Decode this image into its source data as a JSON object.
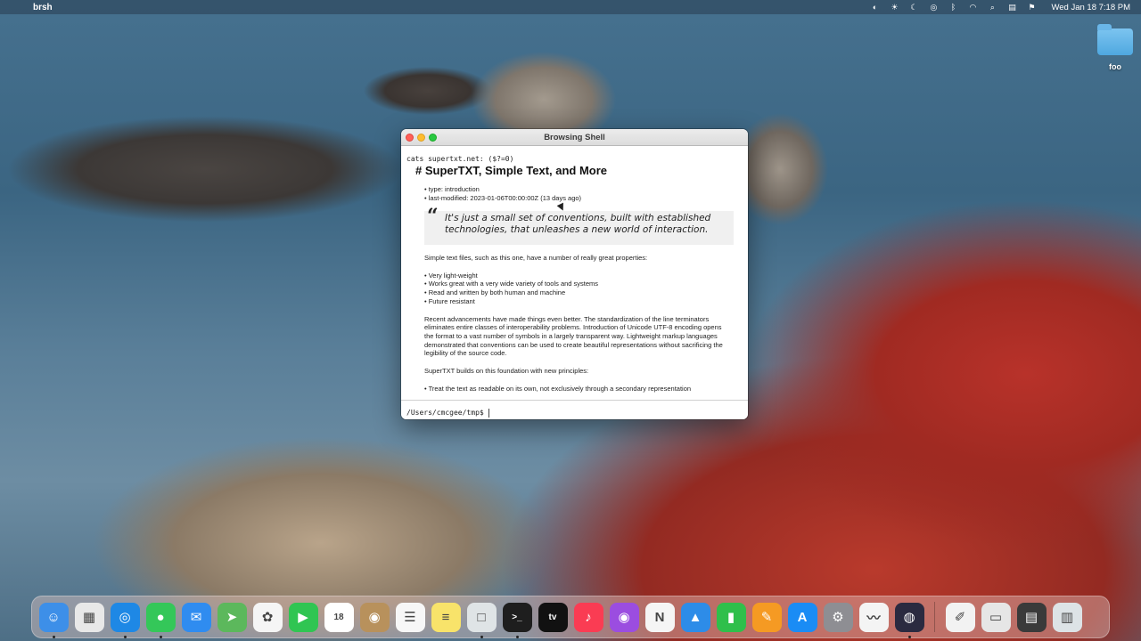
{
  "menubar": {
    "app_name": "brsh",
    "datetime": "Wed Jan 18  7:18 PM",
    "status_icons": [
      "screen-mirroring-icon",
      "brightness-icon",
      "moon-icon",
      "user-icon",
      "bluetooth-icon",
      "wifi-icon",
      "search-icon",
      "control-center-icon",
      "flag-icon"
    ]
  },
  "desktop": {
    "folder_label": "foo"
  },
  "window": {
    "title": "Browsing Shell",
    "command": "cats supertxt.net: ($?=0)",
    "heading": "# SuperTXT, Simple Text, and More",
    "meta": [
      "• type: introduction",
      "• last-modified: 2023-01-06T00:00:00Z (13 days ago)"
    ],
    "quote_mark": "“",
    "quote": "It's just a small set of conventions, built with established technologies, that unleashes a new world of interaction.",
    "intro": "Simple text files, such as this one, have a number of really great properties:",
    "properties": [
      "• Very light-weight",
      "• Works great with a very wide variety of tools and systems",
      "• Read and written by both human and machine",
      "• Future resistant"
    ],
    "advancements": "Recent advancements have made things even better. The standardization of the line terminators eliminates entire classes of interoperability problems. Introduction of Unicode UTF-8 encoding opens the format to a vast number of symbols in a largely transparent way. Lightweight markup languages demonstrated that conventions can be used to create beautiful representations without sacrificing the legibility of the source code.",
    "builds_on": "SuperTXT builds on this foundation with new principles:",
    "principles": [
      "• Treat the text as readable on its own, not exclusively through a secondary representation"
    ],
    "prompt": "/Users/cmcgee/tmp$",
    "prompt_value": ""
  },
  "dock": {
    "items": [
      {
        "name": "finder",
        "color": "#3d8fe8",
        "glyph": "☺",
        "running": true
      },
      {
        "name": "launchpad",
        "color": "#e8e8e8",
        "glyph": "▦",
        "running": false
      },
      {
        "name": "safari",
        "color": "#1e88e5",
        "glyph": "◎",
        "running": true
      },
      {
        "name": "messages",
        "color": "#34c759",
        "glyph": "●",
        "running": true
      },
      {
        "name": "mail",
        "color": "#2f8cf0",
        "glyph": "✉",
        "running": false
      },
      {
        "name": "maps",
        "color": "#5cb85c",
        "glyph": "➤",
        "running": false
      },
      {
        "name": "photos",
        "color": "#f5f5f5",
        "glyph": "✿",
        "running": false
      },
      {
        "name": "facetime",
        "color": "#30c552",
        "glyph": "▶",
        "running": false
      },
      {
        "name": "calendar",
        "color": "#ffffff",
        "glyph": "18",
        "running": false
      },
      {
        "name": "contacts",
        "color": "#b8915c",
        "glyph": "◉",
        "running": false
      },
      {
        "name": "reminders",
        "color": "#f7f7f7",
        "glyph": "☰",
        "running": false
      },
      {
        "name": "notes",
        "color": "#f8e36a",
        "glyph": "≡",
        "running": false
      },
      {
        "name": "freeform",
        "color": "#dfe4e6",
        "glyph": "□",
        "running": true
      },
      {
        "name": "terminal",
        "color": "#1e1e1e",
        "glyph": ">_",
        "running": true
      },
      {
        "name": "apple-tv",
        "color": "#111111",
        "glyph": "tv",
        "running": false
      },
      {
        "name": "music",
        "color": "#fa3c53",
        "glyph": "♪",
        "running": false
      },
      {
        "name": "podcasts",
        "color": "#9b4de0",
        "glyph": "◉",
        "running": false
      },
      {
        "name": "news",
        "color": "#f5f5f5",
        "glyph": "N",
        "running": false
      },
      {
        "name": "keynote",
        "color": "#2d8ce8",
        "glyph": "▲",
        "running": false
      },
      {
        "name": "numbers",
        "color": "#2fbf4b",
        "glyph": "▮",
        "running": false
      },
      {
        "name": "pages",
        "color": "#f59a23",
        "glyph": "✎",
        "running": false
      },
      {
        "name": "app-store",
        "color": "#1a8cf5",
        "glyph": "A",
        "running": false
      },
      {
        "name": "system-settings",
        "color": "#8e8e93",
        "glyph": "⚙",
        "running": false
      },
      {
        "name": "freeform-2",
        "color": "#f4f4f4",
        "glyph": "〰",
        "running": false
      },
      {
        "name": "obs",
        "color": "#2a2a40",
        "glyph": "◍",
        "running": true
      },
      {
        "name": "textedit",
        "color": "#f2f2f2",
        "glyph": "✐",
        "running": false
      },
      {
        "name": "file-doc",
        "color": "#e6e6e6",
        "glyph": "▭",
        "running": false
      },
      {
        "name": "screen-window",
        "color": "#3a3a3a",
        "glyph": "▤",
        "running": false
      },
      {
        "name": "trash",
        "color": "#dde3e6",
        "glyph": "▥",
        "running": false
      }
    ]
  }
}
